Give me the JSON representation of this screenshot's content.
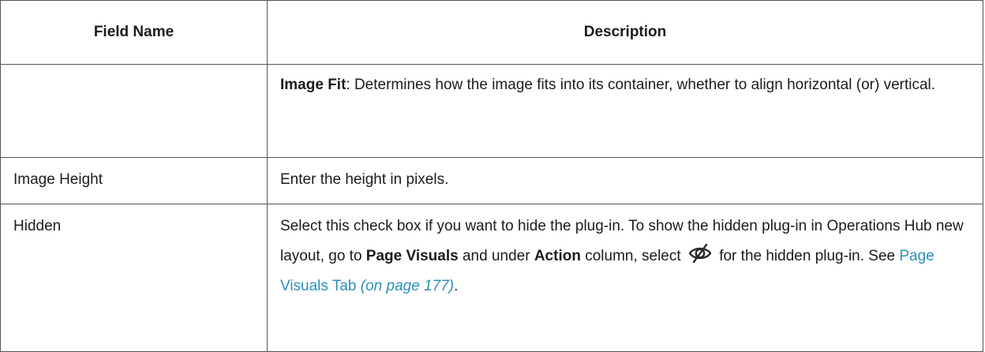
{
  "table": {
    "headers": {
      "field_name": "Field Name",
      "description": "Description"
    },
    "rows": [
      {
        "field_name": "",
        "term": "Image Fit",
        "text": ": Determines how the image fits into its container, whether to align horizontal (or) vertical."
      },
      {
        "field_name": "Image Height",
        "text": "Enter the height in pixels."
      },
      {
        "field_name": "Hidden",
        "text_1": "Select this check box if you want to hide the plug-in. To show the hidden plug-in in Operations Hub new layout, go to ",
        "term_1": "Page Visuals",
        "text_2": " and under ",
        "term_2": "Action",
        "text_3": " column, select ",
        "icon": "hidden-eye-icon",
        "text_4": " for the hidden plug-in. See ",
        "link_text": "Page Visuals Tab",
        "link_page": "(on page 177)",
        "text_5": "."
      }
    ]
  },
  "colors": {
    "link": "#2e8fb8",
    "border": "#555555",
    "text": "#1c1c1c"
  }
}
